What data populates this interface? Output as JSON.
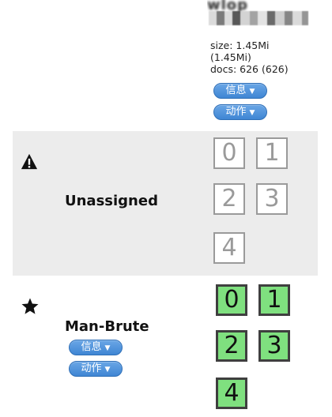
{
  "index": {
    "name": "wlop",
    "stats": {
      "size": "size: 1.45Mi",
      "size_primary": "(1.45Mi)",
      "docs": "docs: 626 (626)"
    },
    "info_label": "信息",
    "action_label": "动作"
  },
  "unassigned": {
    "icon": "warning-triangle-icon",
    "label": "Unassigned",
    "shards": [
      "0",
      "1",
      "2",
      "3",
      "4"
    ]
  },
  "node": {
    "icon": "star-icon",
    "name": "Man-Brute",
    "info_label": "信息",
    "action_label": "动作",
    "shards": [
      "0",
      "1",
      "2",
      "3",
      "4"
    ]
  },
  "colors": {
    "shard_started": "#7fe07f",
    "shard_unassigned_border": "#9a9a9a",
    "pill_blue": "#3f86d4",
    "unassigned_bg": "#ececec"
  }
}
